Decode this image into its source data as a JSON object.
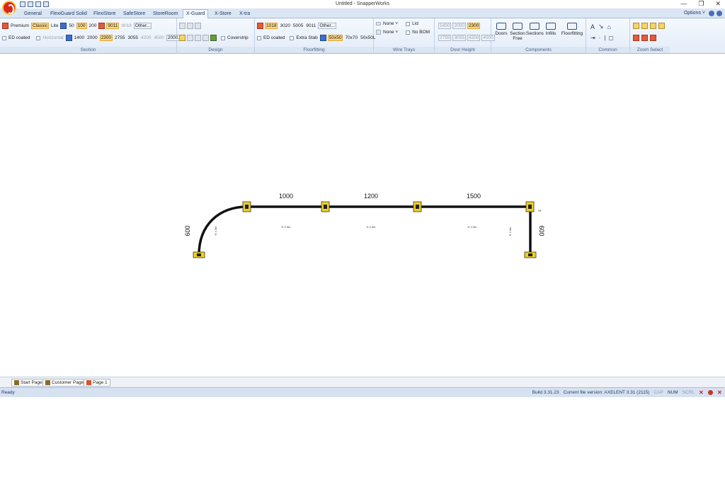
{
  "window": {
    "title": "Untitled - SnapperWorks",
    "controls": [
      "—",
      "❐",
      "✕"
    ]
  },
  "tabs": [
    "General",
    "FlexiGuard Solid",
    "FlexiStore",
    "SafeStore",
    "StoreRoom",
    "X-Guard",
    "X-Store",
    "X-tra"
  ],
  "active_tab": "X-Guard",
  "options_label": "Options ˅",
  "ribbon": {
    "section": {
      "label": "Section",
      "types": [
        "Premium",
        "Classic",
        "Lite"
      ],
      "selected_type": "Classic",
      "widths": [
        "50",
        "100",
        "200"
      ],
      "selected_width": "100",
      "colors": [
        "9011",
        "9018",
        "Other..."
      ],
      "selected_color": "9011",
      "ed_coated": "ED coated",
      "horizontal": "Horizontal",
      "heights": [
        "1400",
        "2000",
        "2300",
        "2755",
        "3055",
        "4200",
        "4500",
        "2000..."
      ],
      "selected_height": "2300"
    },
    "design": {
      "label": "Design",
      "coverstrip": "Coverstrip"
    },
    "floorfitting": {
      "label": "Floorfitting",
      "colors": [
        "1018",
        "3020",
        "5005",
        "9011",
        "Other..."
      ],
      "selected_color": "1018",
      "ed_coated": "ED coated",
      "extra_stab": "Extra Stab",
      "sizes": [
        "50x50",
        "70x70",
        "50x50L"
      ],
      "selected_size": "50x50"
    },
    "wire_trays": {
      "label": "Wire Trays",
      "top": "None ˅",
      "bottom": "None ˅",
      "lid": "Lid",
      "no_bom": "No BOM"
    },
    "door_height": {
      "label": "Door Height",
      "values": [
        "1400",
        "2000",
        "2300",
        "2755",
        "3055",
        "4200",
        "4500"
      ],
      "selected": "2300"
    },
    "components": {
      "label": "Components",
      "buttons": [
        "Doors",
        "Section Free",
        "Sections",
        "Infills",
        "Floorfitting"
      ]
    },
    "common": {
      "label": "Common"
    },
    "zoom_select": {
      "label": "Zoom Select"
    }
  },
  "drawing": {
    "dimensions": [
      "1000",
      "1200",
      "1500",
      "600",
      "600"
    ],
    "height_labels": [
      "H 2.3m",
      "H 2.3m",
      "H 2.3m",
      "H 2.3m",
      "H 2.3m"
    ],
    "end_marker": "SF"
  },
  "page_tabs": [
    "Start Page",
    "Customer Page",
    "Page 1"
  ],
  "status": {
    "left": "Ready",
    "build": "Build 3.31.23",
    "file_version": "Current file version: AXELENT 3.31 (2115)",
    "cap": "CAP",
    "num": "NUM",
    "scrl": "SCRL"
  }
}
